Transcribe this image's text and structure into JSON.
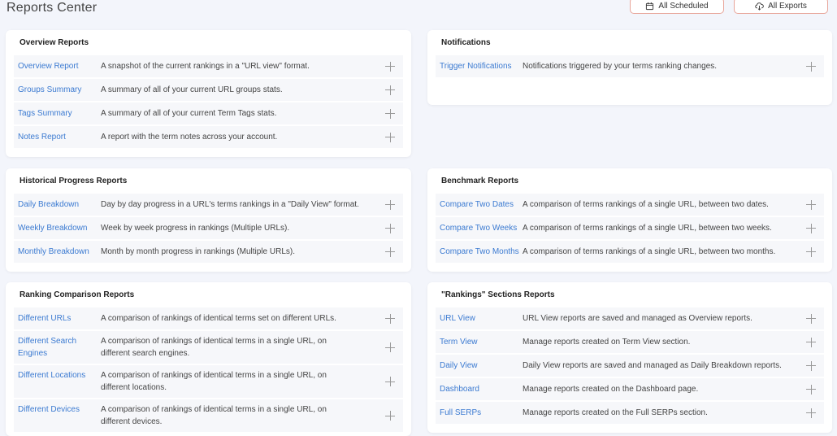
{
  "header": {
    "title": "Reports Center",
    "scheduled_label": "All Scheduled",
    "exports_label": "All Exports"
  },
  "cards": {
    "overview": {
      "title": "Overview Reports",
      "rows": [
        {
          "label": "Overview Report",
          "desc": "A snapshot of the current rankings in a \"URL view\" format."
        },
        {
          "label": "Groups Summary",
          "desc": "A summary of all of your current URL groups stats."
        },
        {
          "label": "Tags Summary",
          "desc": "A summary of all of your current Term Tags stats."
        },
        {
          "label": "Notes Report",
          "desc": "A report with the term notes across your account."
        }
      ]
    },
    "notifications": {
      "title": "Notifications",
      "rows": [
        {
          "label": "Trigger Notifications",
          "desc": "Notifications triggered by your terms ranking changes."
        }
      ]
    },
    "historical": {
      "title": "Historical Progress Reports",
      "rows": [
        {
          "label": "Daily Breakdown",
          "desc": "Day by day progress in a URL's terms rankings in a \"Daily View\" format."
        },
        {
          "label": "Weekly Breakdown",
          "desc": "Week by week progress in rankings (Multiple URLs)."
        },
        {
          "label": "Monthly Breakdown",
          "desc": "Month by month progress in rankings (Multiple URLs)."
        }
      ]
    },
    "benchmark": {
      "title": "Benchmark Reports",
      "rows": [
        {
          "label": "Compare Two Dates",
          "desc": "A comparison of terms rankings of a single URL, between two dates."
        },
        {
          "label": "Compare Two Weeks",
          "desc": "A comparison of terms rankings of a single URL, between two weeks."
        },
        {
          "label": "Compare Two Months",
          "desc": "A comparison of terms rankings of a single URL, between two months."
        }
      ]
    },
    "ranking": {
      "title": "Ranking Comparison Reports",
      "rows": [
        {
          "label": "Different URLs",
          "desc": "A comparison of rankings of identical terms set on different URLs."
        },
        {
          "label": "Different Search Engines",
          "desc": "A comparison of rankings of identical terms in a single URL, on different search engines."
        },
        {
          "label": "Different Locations",
          "desc": "A comparison of rankings of identical terms in a single URL, on different locations."
        },
        {
          "label": "Different Devices",
          "desc": "A comparison of rankings of identical terms in a single URL, on different devices."
        }
      ]
    },
    "sections": {
      "title": "\"Rankings\" Sections Reports",
      "rows": [
        {
          "label": "URL View",
          "desc": "URL View reports are saved and managed as Overview reports."
        },
        {
          "label": "Term View",
          "desc": "Manage reports created on Term View section."
        },
        {
          "label": "Daily View",
          "desc": "Daily View reports are saved and managed as Daily Breakdown reports."
        },
        {
          "label": "Dashboard",
          "desc": "Manage reports created on the Dashboard page."
        },
        {
          "label": "Full SERPs",
          "desc": "Manage reports created on the Full SERPs section."
        }
      ]
    }
  }
}
